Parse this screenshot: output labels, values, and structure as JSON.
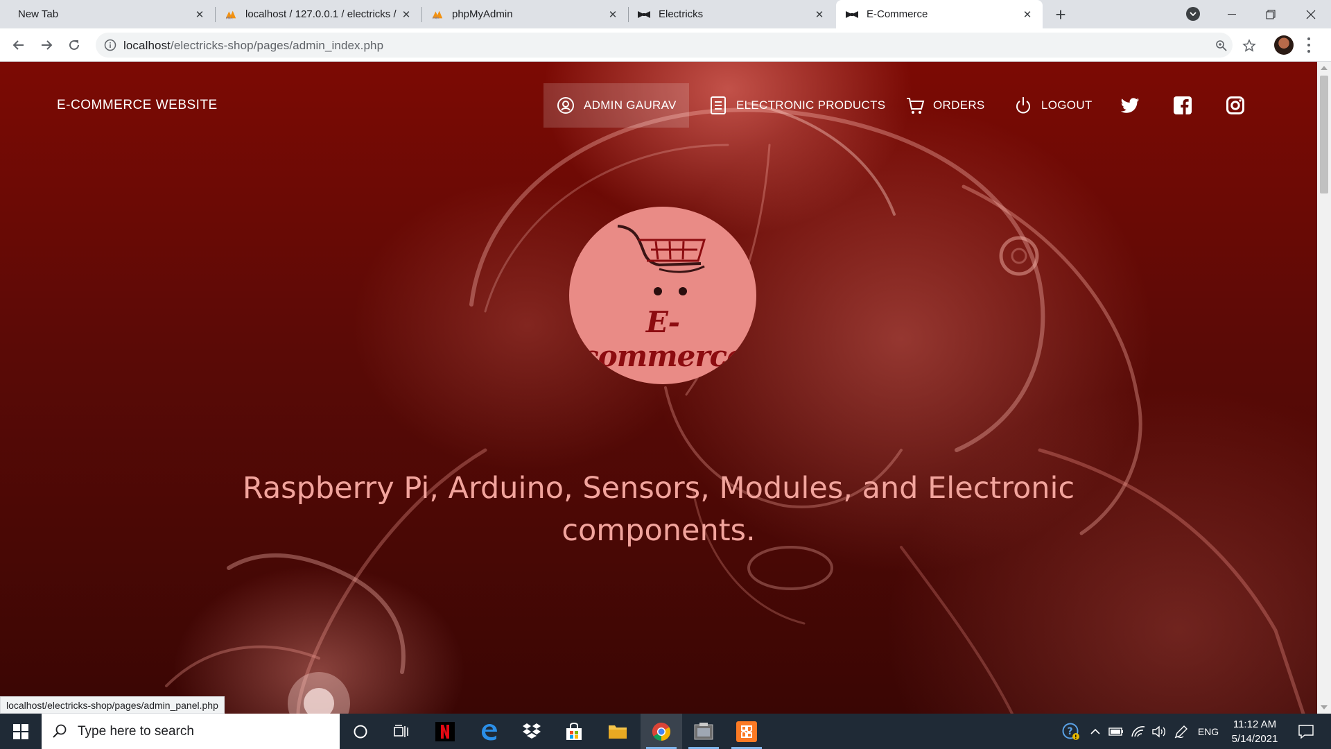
{
  "browser": {
    "tabs": [
      {
        "title": "New Tab",
        "favicon": "none"
      },
      {
        "title": "localhost / 127.0.0.1 / electricks /",
        "favicon": "phpmyadmin-icon"
      },
      {
        "title": "phpMyAdmin",
        "favicon": "phpmyadmin-icon"
      },
      {
        "title": "Electricks",
        "favicon": "bowtie-icon"
      },
      {
        "title": "E-Commerce",
        "favicon": "bowtie-icon"
      }
    ],
    "active_tab_index": 4,
    "url_host": "localhost",
    "url_path": "/electricks-shop/pages/admin_index.php",
    "status_url": "localhost/electricks-shop/pages/admin_panel.php"
  },
  "site": {
    "brand": "E-COMMERCE WEBSITE",
    "nav": [
      {
        "label": "ADMIN GAURAV",
        "icon": "user-circle-icon",
        "active": true
      },
      {
        "label": "ELECTRONIC PRODUCTS",
        "icon": "list-icon",
        "active": false
      },
      {
        "label": "ORDERS",
        "icon": "cart-icon",
        "active": false
      },
      {
        "label": "LOGOUT",
        "icon": "power-icon",
        "active": false
      }
    ],
    "social": [
      "twitter-icon",
      "facebook-icon",
      "instagram-icon"
    ],
    "logo_text": "E-commerce",
    "headline_line1": "Raspberry Pi, Arduino, Sensors, Modules, and Electronic",
    "headline_line2": "components.",
    "accent_color": "#7c0a04"
  },
  "taskbar": {
    "search_placeholder": "Type here to search",
    "language": "ENG",
    "time": "11:12 AM",
    "date": "5/14/2021"
  }
}
